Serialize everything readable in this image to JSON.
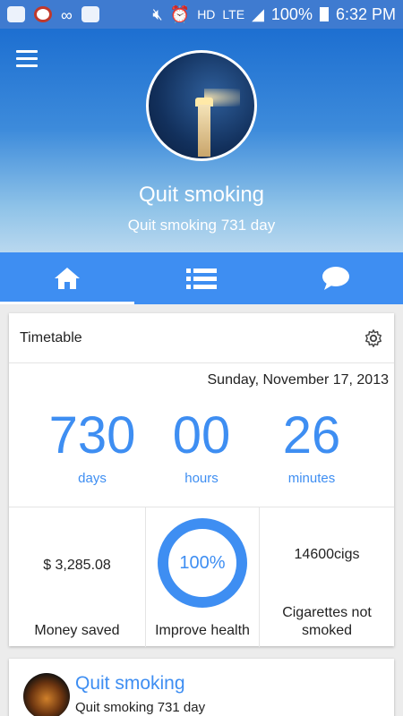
{
  "status_bar": {
    "battery": "100%",
    "time": "6:32 PM",
    "network": "LTE",
    "hd": "HD"
  },
  "header": {
    "title": "Quit smoking",
    "subtitle": "Quit smoking 731 day"
  },
  "tabs": [
    {
      "icon": "home-icon",
      "active": true
    },
    {
      "icon": "list-icon",
      "active": false
    },
    {
      "icon": "chat-icon",
      "active": false
    }
  ],
  "timetable": {
    "title": "Timetable",
    "date": "Sunday, November 17, 2013",
    "days": "730",
    "days_label": "days",
    "hours": "00",
    "hours_label": "hours",
    "minutes": "26",
    "minutes_label": "minutes"
  },
  "stats": {
    "money_value": "$  3,285.08",
    "money_label": "Money saved",
    "health_value": "100%",
    "health_label": "Improve health",
    "health_fraction": 1.0,
    "cigs_value": "14600cigs",
    "cigs_label": "Cigarettes not smoked"
  },
  "profile_card": {
    "title": "Quit smoking",
    "subtitle": "Quit smoking 731 day"
  },
  "colors": {
    "accent": "#3e8ef2",
    "status_bar": "#3f7bd0"
  }
}
